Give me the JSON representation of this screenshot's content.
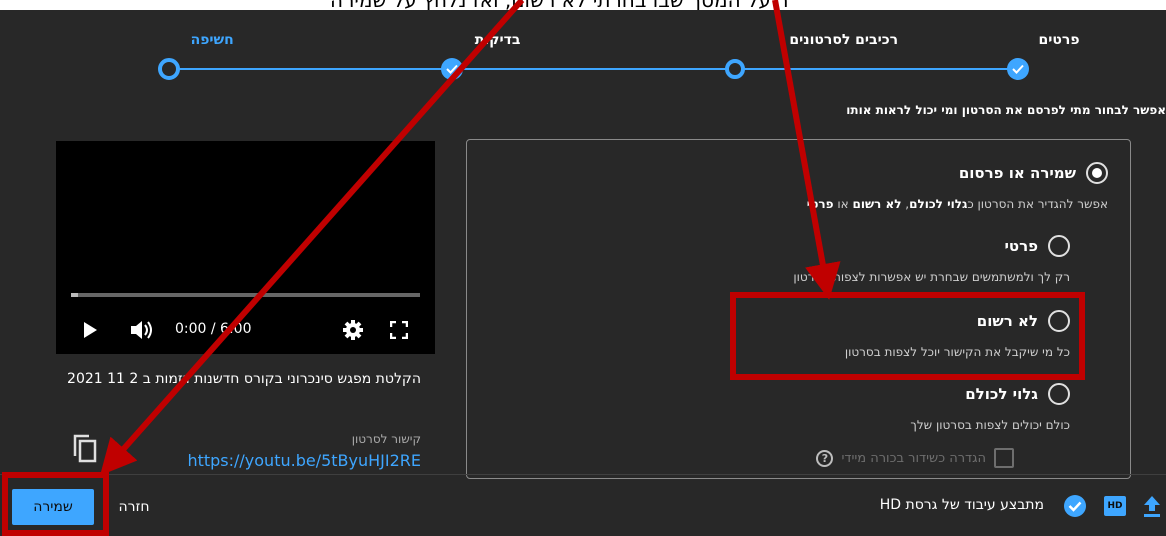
{
  "top_cut_text": "ר על המסך שבו בחרתי לא רשום, ואז נלחץ על שמירה",
  "steps": [
    {
      "label": "פרטים",
      "state": "done"
    },
    {
      "label": "רכיבים לסרטונים",
      "state": "current-dot"
    },
    {
      "label": "בדיקות",
      "state": "done"
    },
    {
      "label": "חשיפה",
      "state": "active"
    }
  ],
  "subtitle": "אפשר לבחור מתי לפרסם את הסרטון ומי יכול לראות אותו",
  "visibility": {
    "section_label": "שמירה או פרסום",
    "section_desc_prefix": "אפשר להגדיר את הסרטון כ",
    "section_desc_public": "גלוי לכולם",
    "section_desc_sep": ", ",
    "section_desc_unlisted": "לא רשום",
    "section_desc_or": " או ",
    "section_desc_private": "פרטי",
    "options": [
      {
        "label": "פרטי",
        "desc": "רק לך ולמשתמשים שבחרת יש אפשרות לצפות בסרטון"
      },
      {
        "label": "לא רשום",
        "desc": "כל מי שיקבל את הקישור יוכל לצפות בסרטון"
      },
      {
        "label": "גלוי לכולם",
        "desc": "כולם יכולים לצפות בסרטון שלך"
      }
    ],
    "premiere_label": "הגדרה כשידור בכורה מיידי",
    "help_glyph": "?"
  },
  "video": {
    "time": "0:00 / 6:00",
    "progress_buffered": 0.02,
    "title": "הקלטת מפגש סינכרוני בקורס חדשנות ויזמות ב 2 11 2021",
    "link_label": "קישור לסרטון",
    "link": "https://youtu.be/5tByuHJI2RE"
  },
  "footer": {
    "save_label": "שמירה",
    "back_label": "חזרה",
    "status": "מתבצע עיבוד של גרסת HD",
    "hd_badge": "HD"
  },
  "colors": {
    "accent": "#3ea6ff",
    "background": "#282828",
    "annotation": "#c00000"
  },
  "icons": [
    "check-icon",
    "play-icon",
    "volume-icon",
    "settings-icon",
    "fullscreen-icon",
    "copy-icon",
    "upload-icon",
    "hd-icon",
    "check-circle-icon",
    "help-icon"
  ]
}
